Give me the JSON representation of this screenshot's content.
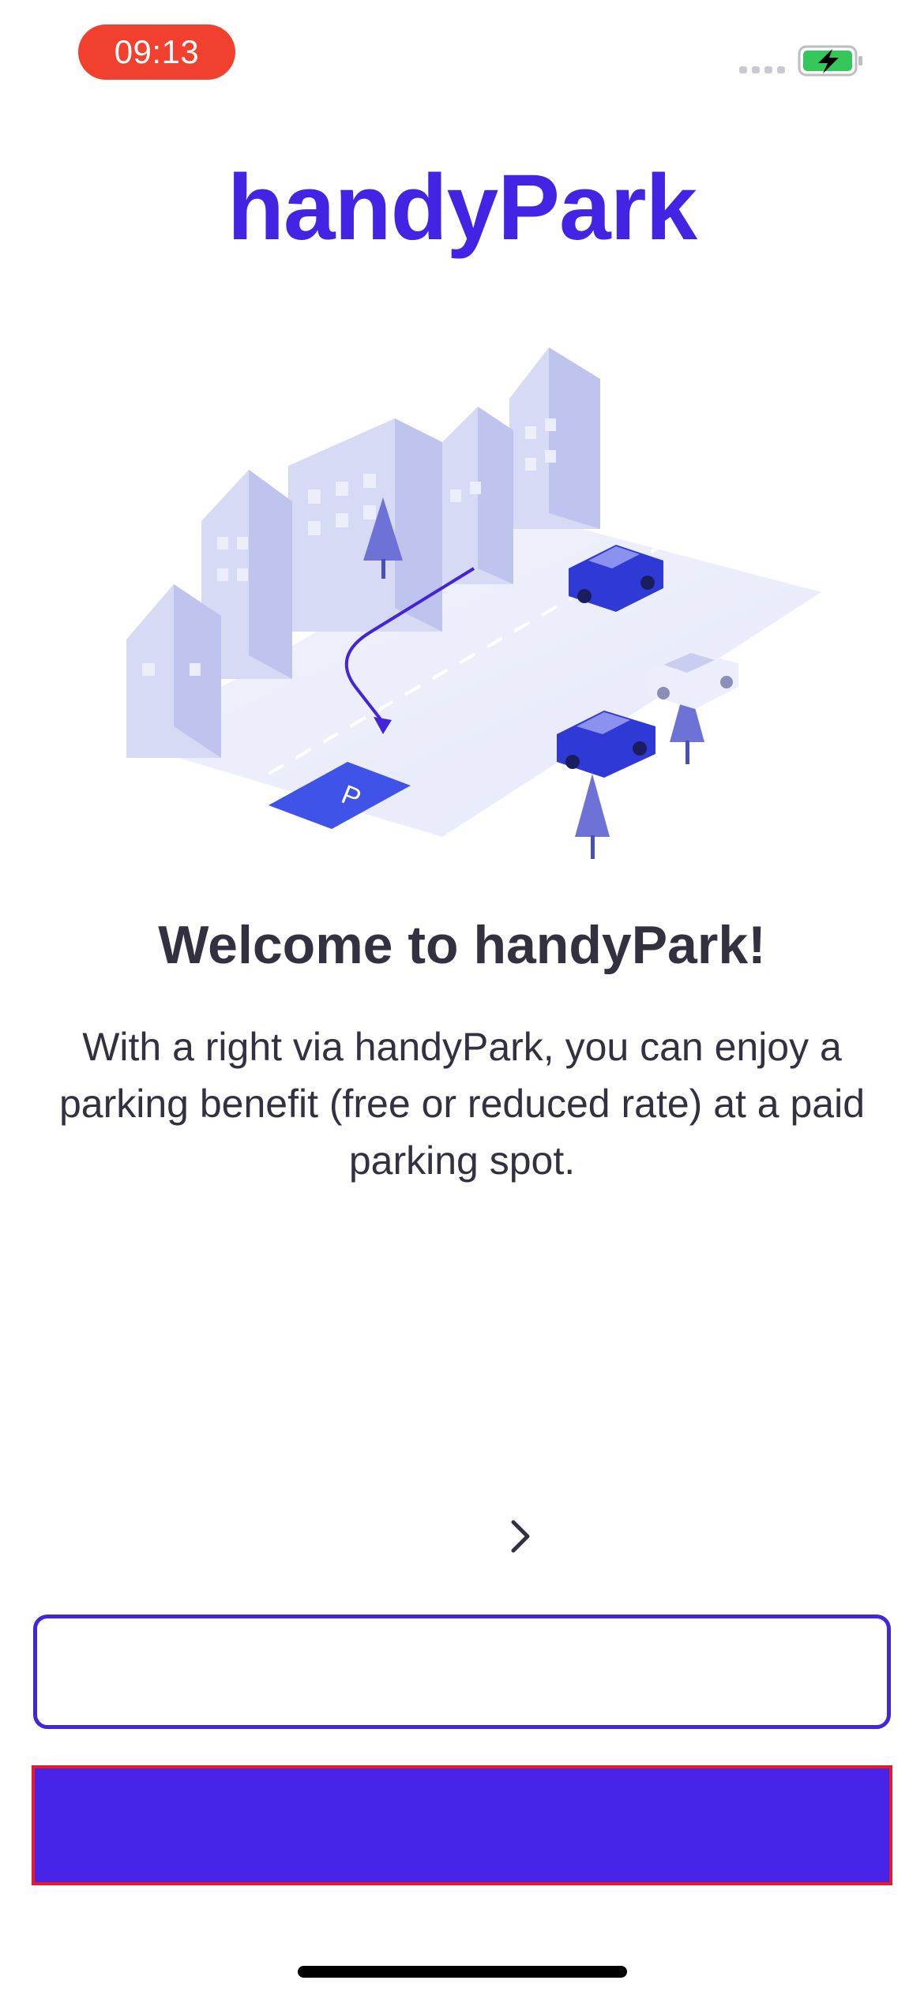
{
  "status_bar": {
    "time": "09:13"
  },
  "logo": {
    "text": "handyPark"
  },
  "illustration": {
    "parking_sign": "P"
  },
  "welcome": {
    "title": "Welcome to handyPark!",
    "description": "With a right via handyPark, you can enjoy a parking benefit (free or reduced rate) at a paid parking spot."
  },
  "buttons": {
    "secondary_label": "",
    "primary_label": ""
  },
  "colors": {
    "brand": "#4324e4",
    "time_pill": "#f2402f",
    "primary_button": "#4724e8",
    "text": "#33313f"
  }
}
